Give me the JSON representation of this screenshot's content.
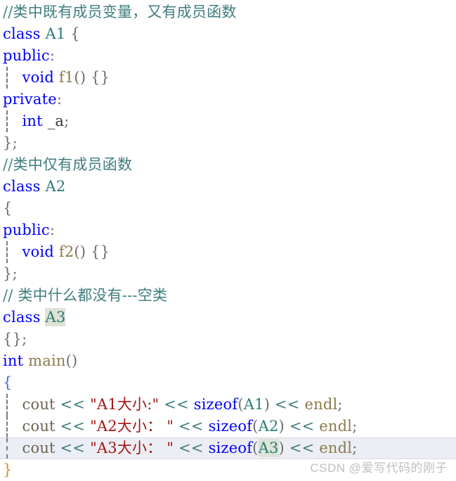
{
  "editor": {
    "background": "#ffffff",
    "font_size_px": 21,
    "line_height_px": 31,
    "current_line_index": 20,
    "current_line_highlight_color": "#eceef5",
    "selection_highlight_color": "#dde3d5",
    "palette": {
      "keyword": "#0000ff",
      "comment": "#3f7d7d",
      "type_name": "#2b7a78",
      "function_name": "#8a7b4a",
      "identifier": "#6b6550",
      "string": "#a31515",
      "operator": "#3f7d7d",
      "punctuation": "#6d6d6d",
      "brace_blue": "#3b6fd4",
      "brace_orange": "#d98a2b"
    }
  },
  "code": {
    "lines": [
      {
        "n": 1,
        "guide": false,
        "current": false,
        "tokens": [
          {
            "t": "//类中既有成员变量，又有成员函数",
            "c": "cmt"
          }
        ]
      },
      {
        "n": 2,
        "guide": false,
        "current": false,
        "tokens": [
          {
            "t": "class",
            "c": "kw"
          },
          {
            "t": " ",
            "c": "plain"
          },
          {
            "t": "A1",
            "c": "type"
          },
          {
            "t": " ",
            "c": "plain"
          },
          {
            "t": "{",
            "c": "pun"
          }
        ]
      },
      {
        "n": 3,
        "guide": false,
        "current": false,
        "tokens": [
          {
            "t": "public",
            "c": "kw"
          },
          {
            "t": ":",
            "c": "pun"
          }
        ]
      },
      {
        "n": 4,
        "guide": true,
        "current": false,
        "tokens": [
          {
            "t": "    ",
            "c": "plain"
          },
          {
            "t": "void",
            "c": "kw"
          },
          {
            "t": " ",
            "c": "plain"
          },
          {
            "t": "f1",
            "c": "fn"
          },
          {
            "t": "()",
            "c": "pun"
          },
          {
            "t": " ",
            "c": "plain"
          },
          {
            "t": "{}",
            "c": "pun"
          }
        ]
      },
      {
        "n": 5,
        "guide": false,
        "current": false,
        "tokens": [
          {
            "t": "private",
            "c": "kw"
          },
          {
            "t": ":",
            "c": "pun"
          }
        ]
      },
      {
        "n": 6,
        "guide": true,
        "current": false,
        "tokens": [
          {
            "t": "    ",
            "c": "plain"
          },
          {
            "t": "int",
            "c": "kw"
          },
          {
            "t": " ",
            "c": "plain"
          },
          {
            "t": "_a",
            "c": "plain"
          },
          {
            "t": ";",
            "c": "pun"
          }
        ]
      },
      {
        "n": 7,
        "guide": false,
        "current": false,
        "tokens": [
          {
            "t": "}",
            "c": "pun"
          },
          {
            "t": ";",
            "c": "pun"
          }
        ]
      },
      {
        "n": 8,
        "guide": false,
        "current": false,
        "tokens": [
          {
            "t": "//类中仅有成员函数",
            "c": "cmt"
          }
        ]
      },
      {
        "n": 9,
        "guide": false,
        "current": false,
        "tokens": [
          {
            "t": "class",
            "c": "kw"
          },
          {
            "t": " ",
            "c": "plain"
          },
          {
            "t": "A2",
            "c": "type"
          }
        ]
      },
      {
        "n": 10,
        "guide": false,
        "current": false,
        "tokens": [
          {
            "t": "{",
            "c": "pun"
          }
        ]
      },
      {
        "n": 11,
        "guide": false,
        "current": false,
        "tokens": [
          {
            "t": "public",
            "c": "kw"
          },
          {
            "t": ":",
            "c": "pun"
          }
        ]
      },
      {
        "n": 12,
        "guide": true,
        "current": false,
        "tokens": [
          {
            "t": "    ",
            "c": "plain"
          },
          {
            "t": "void",
            "c": "kw"
          },
          {
            "t": " ",
            "c": "plain"
          },
          {
            "t": "f2",
            "c": "fn"
          },
          {
            "t": "()",
            "c": "pun"
          },
          {
            "t": " ",
            "c": "plain"
          },
          {
            "t": "{}",
            "c": "pun"
          }
        ]
      },
      {
        "n": 13,
        "guide": false,
        "current": false,
        "tokens": [
          {
            "t": "}",
            "c": "pun"
          },
          {
            "t": ";",
            "c": "pun"
          }
        ]
      },
      {
        "n": 14,
        "guide": false,
        "current": false,
        "tokens": [
          {
            "t": "// 类中什么都没有---空类",
            "c": "cmt"
          }
        ]
      },
      {
        "n": 15,
        "guide": false,
        "current": false,
        "tokens": [
          {
            "t": "class",
            "c": "kw"
          },
          {
            "t": " ",
            "c": "plain"
          },
          {
            "t": "A3",
            "c": "type",
            "sel": true
          }
        ]
      },
      {
        "n": 16,
        "guide": false,
        "current": false,
        "tokens": [
          {
            "t": "{}",
            "c": "pun"
          },
          {
            "t": ";",
            "c": "pun"
          }
        ]
      },
      {
        "n": 17,
        "guide": false,
        "current": false,
        "tokens": [
          {
            "t": "int",
            "c": "kw"
          },
          {
            "t": " ",
            "c": "plain"
          },
          {
            "t": "main",
            "c": "fn"
          },
          {
            "t": "()",
            "c": "pun"
          }
        ]
      },
      {
        "n": 18,
        "guide": false,
        "current": false,
        "tokens": [
          {
            "t": "{",
            "c": "brace-b"
          }
        ]
      },
      {
        "n": 19,
        "guide": true,
        "current": false,
        "tokens": [
          {
            "t": "    ",
            "c": "plain"
          },
          {
            "t": "cout",
            "c": "id"
          },
          {
            "t": " ",
            "c": "plain"
          },
          {
            "t": "<<",
            "c": "op"
          },
          {
            "t": " ",
            "c": "plain"
          },
          {
            "t": "\"A1大小:\"",
            "c": "str"
          },
          {
            "t": " ",
            "c": "plain"
          },
          {
            "t": "<<",
            "c": "op"
          },
          {
            "t": " ",
            "c": "plain"
          },
          {
            "t": "sizeof",
            "c": "kw"
          },
          {
            "t": "(",
            "c": "pun"
          },
          {
            "t": "A1",
            "c": "type"
          },
          {
            "t": ")",
            "c": "pun"
          },
          {
            "t": " ",
            "c": "plain"
          },
          {
            "t": "<<",
            "c": "op"
          },
          {
            "t": " ",
            "c": "plain"
          },
          {
            "t": "endl",
            "c": "fn"
          },
          {
            "t": ";",
            "c": "pun"
          }
        ]
      },
      {
        "n": 20,
        "guide": true,
        "current": false,
        "tokens": [
          {
            "t": "    ",
            "c": "plain"
          },
          {
            "t": "cout",
            "c": "id"
          },
          {
            "t": " ",
            "c": "plain"
          },
          {
            "t": "<<",
            "c": "op"
          },
          {
            "t": " ",
            "c": "plain"
          },
          {
            "t": "\"A2大小： \"",
            "c": "str"
          },
          {
            "t": " ",
            "c": "plain"
          },
          {
            "t": "<<",
            "c": "op"
          },
          {
            "t": " ",
            "c": "plain"
          },
          {
            "t": "sizeof",
            "c": "kw"
          },
          {
            "t": "(",
            "c": "pun"
          },
          {
            "t": "A2",
            "c": "type"
          },
          {
            "t": ")",
            "c": "pun"
          },
          {
            "t": " ",
            "c": "plain"
          },
          {
            "t": "<<",
            "c": "op"
          },
          {
            "t": " ",
            "c": "plain"
          },
          {
            "t": "endl",
            "c": "fn"
          },
          {
            "t": ";",
            "c": "pun"
          }
        ]
      },
      {
        "n": 21,
        "guide": true,
        "current": true,
        "tokens": [
          {
            "t": "    ",
            "c": "plain"
          },
          {
            "t": "cout",
            "c": "id"
          },
          {
            "t": " ",
            "c": "plain"
          },
          {
            "t": "<<",
            "c": "op"
          },
          {
            "t": " ",
            "c": "plain"
          },
          {
            "t": "\"A3大小： \"",
            "c": "str"
          },
          {
            "t": " ",
            "c": "plain"
          },
          {
            "t": "<<",
            "c": "op"
          },
          {
            "t": " ",
            "c": "plain"
          },
          {
            "t": "sizeof",
            "c": "kw"
          },
          {
            "t": "(",
            "c": "pun"
          },
          {
            "t": "A3",
            "c": "type",
            "sel": true
          },
          {
            "t": ")",
            "c": "pun"
          },
          {
            "t": " ",
            "c": "plain"
          },
          {
            "t": "<<",
            "c": "op"
          },
          {
            "t": " ",
            "c": "plain"
          },
          {
            "t": "endl",
            "c": "fn"
          },
          {
            "t": ";",
            "c": "pun"
          }
        ]
      },
      {
        "n": 22,
        "guide": false,
        "current": false,
        "tokens": [
          {
            "t": "}",
            "c": "brace-o"
          }
        ]
      }
    ]
  },
  "watermark": {
    "text": "CSDN @爱写代码的刚子"
  }
}
